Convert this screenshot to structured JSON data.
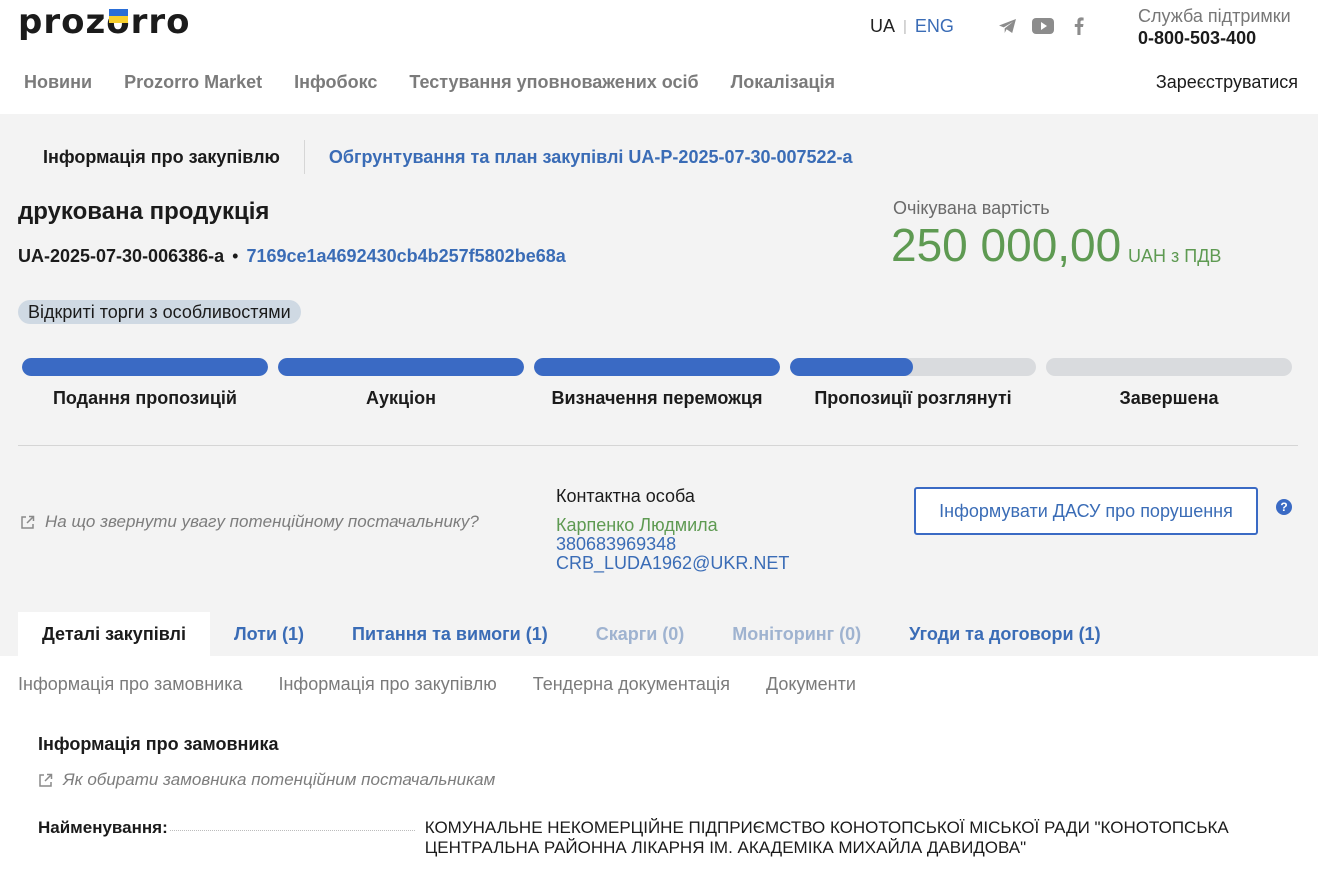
{
  "header": {
    "logo_left": "proz",
    "logo_o": "o",
    "logo_right": "rro",
    "lang_ua": "UA",
    "lang_eng": "ENG",
    "social": [
      "telegram-icon",
      "youtube-icon",
      "facebook-icon"
    ],
    "support_label": "Служба підтримки",
    "support_phone": "0-800-503-400"
  },
  "nav": {
    "items": [
      "Новини",
      "Prozorro Market",
      "Інфобокс",
      "Тестування уповноважених осіб",
      "Локалізація"
    ],
    "register": "Зареєструватися"
  },
  "breadcrumbs": {
    "current": "Інформація про закупівлю",
    "plan_link": "Обгрунтування та план закупівлі UA-P-2025-07-30-007522-a"
  },
  "tender": {
    "title": "друкована продукція",
    "id": "UA-2025-07-30-006386-a",
    "separator": "•",
    "hash": "7169ce1a4692430cb4b257f5802be68a",
    "procedure": "Відкриті торги з особливостями",
    "amount_label": "Очікувана вартість",
    "amount": "250 000,00",
    "currency": "UAH з ПДВ"
  },
  "stages": [
    {
      "label": "Подання пропозицій",
      "progress": 1.0
    },
    {
      "label": "Аукціон",
      "progress": 1.0
    },
    {
      "label": "Визначення переможця",
      "progress": 1.0
    },
    {
      "label": "Пропозиції розглянуті",
      "progress": 0.5
    },
    {
      "label": "Завершена",
      "progress": 0.0
    }
  ],
  "hint": "На що звернути увагу потенційному постачальнику?",
  "contact": {
    "title": "Контактна особа",
    "name": "Карпенко Людмила",
    "phone": "380683969348",
    "email": "CRB_LUDA1962@UKR.NET"
  },
  "dasu_button": "Інформувати ДАСУ про порушення",
  "help_glyph": "?",
  "tabs": [
    {
      "label": "Деталі закупівлі",
      "state": "active"
    },
    {
      "label": "Лоти (1)",
      "state": "normal"
    },
    {
      "label": "Питання та вимоги (1)",
      "state": "normal"
    },
    {
      "label": "Скарги (0)",
      "state": "disabled"
    },
    {
      "label": "Моніторинг (0)",
      "state": "disabled"
    },
    {
      "label": "Угоди та договори (1)",
      "state": "normal"
    }
  ],
  "subtabs": [
    "Інформація про замовника",
    "Інформація про закупівлю",
    "Тендерна документація",
    "Документи"
  ],
  "customer": {
    "section_title": "Інформація про замовника",
    "hint": "Як обирати замовника потенційним постачальникам",
    "name_label": "Найменування:",
    "name_value": "КОМУНАЛЬНЕ НЕКОМЕРЦІЙНЕ ПІДПРИЄМСТВО КОНОТОПСЬКОЇ МІСЬКОЇ РАДИ \"КОНОТОПСЬКА ЦЕНТРАЛЬНА РАЙОННА ЛІКАРНЯ ІМ. АКАДЕМІКА МИХАЙЛА ДАВИДОВА\""
  },
  "colors": {
    "accent": "#3a6ac4",
    "link": "#3a6cb6",
    "amount": "#5e9a52",
    "background": "#f3f3f3"
  }
}
